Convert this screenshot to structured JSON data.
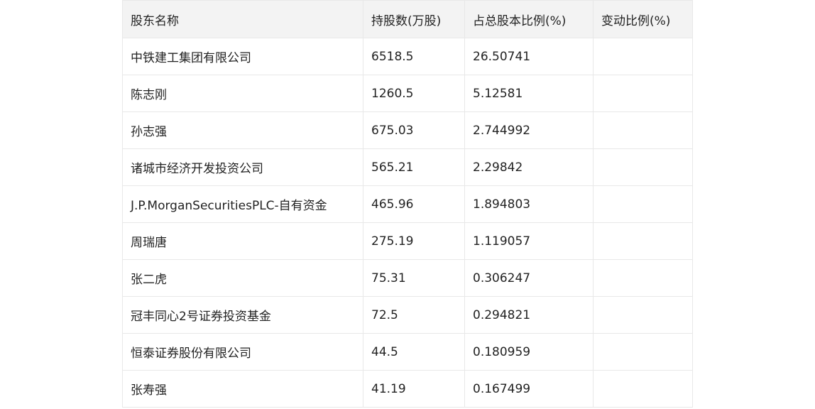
{
  "table": {
    "headers": [
      "股东名称",
      "持股数(万股)",
      "占总股本比例(%)",
      "变动比例(%)"
    ],
    "rows": [
      {
        "name": "中铁建工集团有限公司",
        "shares": "6518.5",
        "ratio": "26.50741",
        "change": ""
      },
      {
        "name": "陈志刚",
        "shares": "1260.5",
        "ratio": "5.12581",
        "change": ""
      },
      {
        "name": "孙志强",
        "shares": "675.03",
        "ratio": "2.744992",
        "change": ""
      },
      {
        "name": "诸城市经济开发投资公司",
        "shares": "565.21",
        "ratio": "2.29842",
        "change": ""
      },
      {
        "name": "J.P.MorganSecuritiesPLC-自有资金",
        "shares": "465.96",
        "ratio": "1.894803",
        "change": ""
      },
      {
        "name": "周瑞唐",
        "shares": "275.19",
        "ratio": "1.119057",
        "change": ""
      },
      {
        "name": "张二虎",
        "shares": "75.31",
        "ratio": "0.306247",
        "change": ""
      },
      {
        "name": "冠丰同心2号证券投资基金",
        "shares": "72.5",
        "ratio": "0.294821",
        "change": ""
      },
      {
        "name": "恒泰证券股份有限公司",
        "shares": "44.5",
        "ratio": "0.180959",
        "change": ""
      },
      {
        "name": "张寿强",
        "shares": "41.19",
        "ratio": "0.167499",
        "change": ""
      }
    ]
  }
}
